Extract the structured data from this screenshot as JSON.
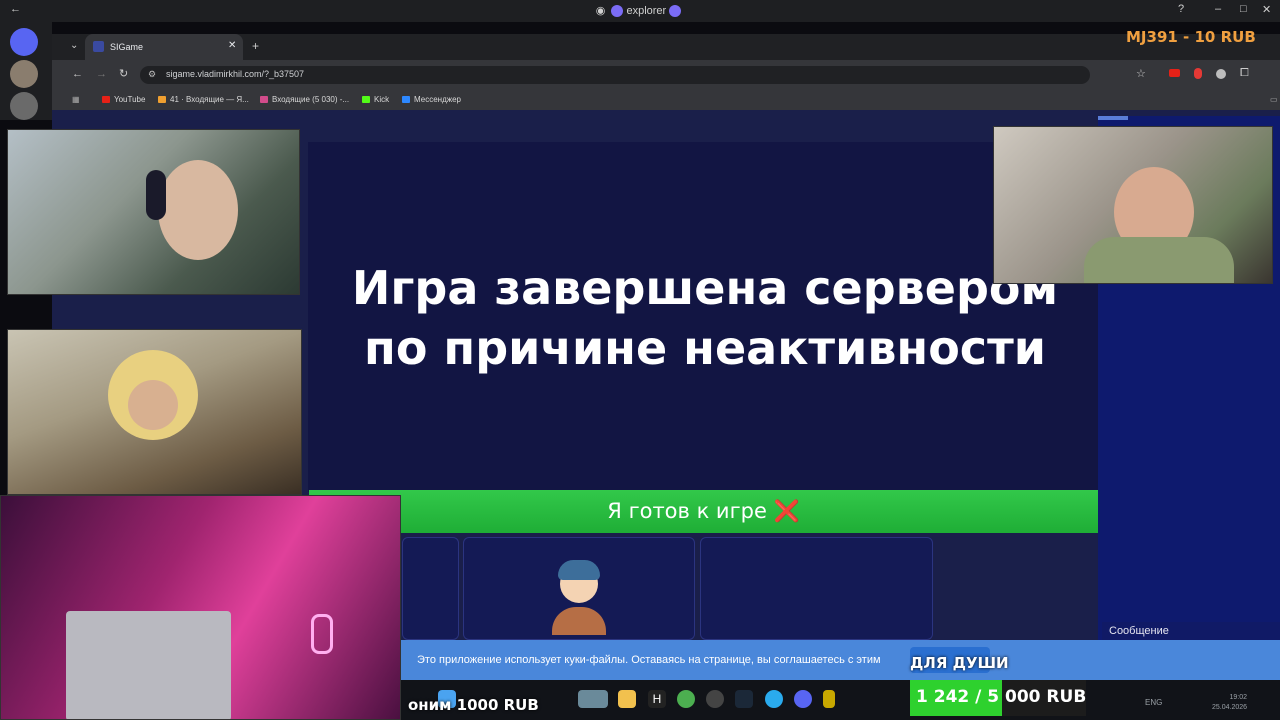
{
  "os": {
    "title": "explorer"
  },
  "browser": {
    "tab_title": "SIGame",
    "url": "sigame.vladimirkhil.com/?_b37507",
    "bookmarks": [
      "YouTube",
      "41 · Входящие — Я...",
      "Входящие (5 030) -...",
      "Kick",
      "Мессенджер"
    ]
  },
  "game": {
    "end_message": "Игра завершена сервером по причине неактивности",
    "ready_button": "Я готов к игре ❌",
    "message_label": "Сообщение",
    "cookie_notice": "Это приложение использует куки-файлы. Оставаясь на странице, вы соглашаетесь с этим"
  },
  "stream": {
    "top_donation": "MJ391 - 10 RUB",
    "goal_title": "ДЛЯ ДУШИ",
    "goal_progress": "1 242 / 5 000 RUB",
    "goal_fraction": 0.248,
    "ticker": "оним 1000 RUB"
  },
  "taskbar": {
    "lang": "ENG",
    "time": "19:02",
    "date": "25.04.2026"
  },
  "colors": {
    "accent_green": "#32c84a",
    "page_bg": "#121543",
    "donation_orange": "#f0a040"
  }
}
